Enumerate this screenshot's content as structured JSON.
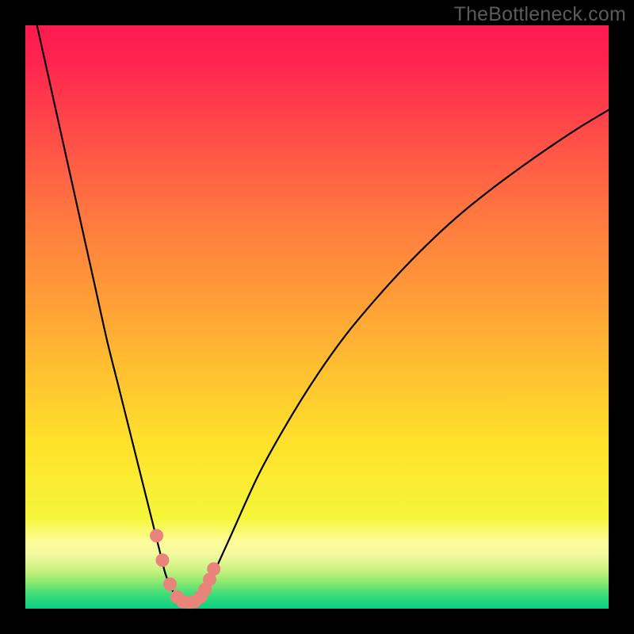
{
  "watermark": "TheBottleneck.com",
  "colors": {
    "frame": "#000000",
    "watermark": "#5b5b5b",
    "gradient_stops": [
      {
        "offset": 0.0,
        "color": "#ff1a4f"
      },
      {
        "offset": 0.06,
        "color": "#ff2450"
      },
      {
        "offset": 0.18,
        "color": "#ff4a48"
      },
      {
        "offset": 0.32,
        "color": "#ff7640"
      },
      {
        "offset": 0.46,
        "color": "#ff9b38"
      },
      {
        "offset": 0.6,
        "color": "#ffc330"
      },
      {
        "offset": 0.72,
        "color": "#ffe22a"
      },
      {
        "offset": 0.845,
        "color": "#f5f63a"
      },
      {
        "offset": 0.885,
        "color": "#fdfd9a"
      },
      {
        "offset": 0.905,
        "color": "#f6f9a0"
      },
      {
        "offset": 0.935,
        "color": "#c8f180"
      },
      {
        "offset": 0.955,
        "color": "#8be86f"
      },
      {
        "offset": 0.975,
        "color": "#3fdd7a"
      },
      {
        "offset": 1.0,
        "color": "#08d083"
      }
    ],
    "curve": "#000000",
    "markers": "#e9847b"
  },
  "chart_data": {
    "type": "line",
    "title": "",
    "xlabel": "",
    "ylabel": "",
    "xlim": [
      0,
      100
    ],
    "ylim": [
      0,
      100
    ],
    "series": [
      {
        "name": "bottleneck-curve",
        "x": [
          2,
          4,
          6,
          8,
          10,
          12,
          14,
          16,
          18,
          20,
          21,
          22,
          23,
          24,
          25,
          26,
          27,
          28,
          29,
          30,
          32,
          35,
          40,
          45,
          50,
          55,
          60,
          65,
          70,
          75,
          80,
          85,
          90,
          95,
          100
        ],
        "values": [
          100,
          91,
          82,
          73,
          64,
          55,
          46,
          38,
          30,
          22,
          18,
          14,
          10,
          6,
          3.5,
          2,
          1.2,
          1,
          1.2,
          2,
          5.5,
          12,
          23,
          32,
          40,
          47,
          53,
          58.5,
          63.5,
          68,
          72,
          75.7,
          79.2,
          82.5,
          85.5
        ]
      }
    ],
    "markers": {
      "name": "highlight-points",
      "x": [
        22.5,
        23.5,
        24.8,
        26.0,
        27.0,
        28.0,
        29.0,
        30.0,
        30.8,
        31.6,
        32.3
      ],
      "values": [
        12.5,
        8.3,
        4.2,
        2.0,
        1.2,
        1.0,
        1.2,
        2.0,
        3.3,
        5.0,
        6.8
      ]
    }
  }
}
